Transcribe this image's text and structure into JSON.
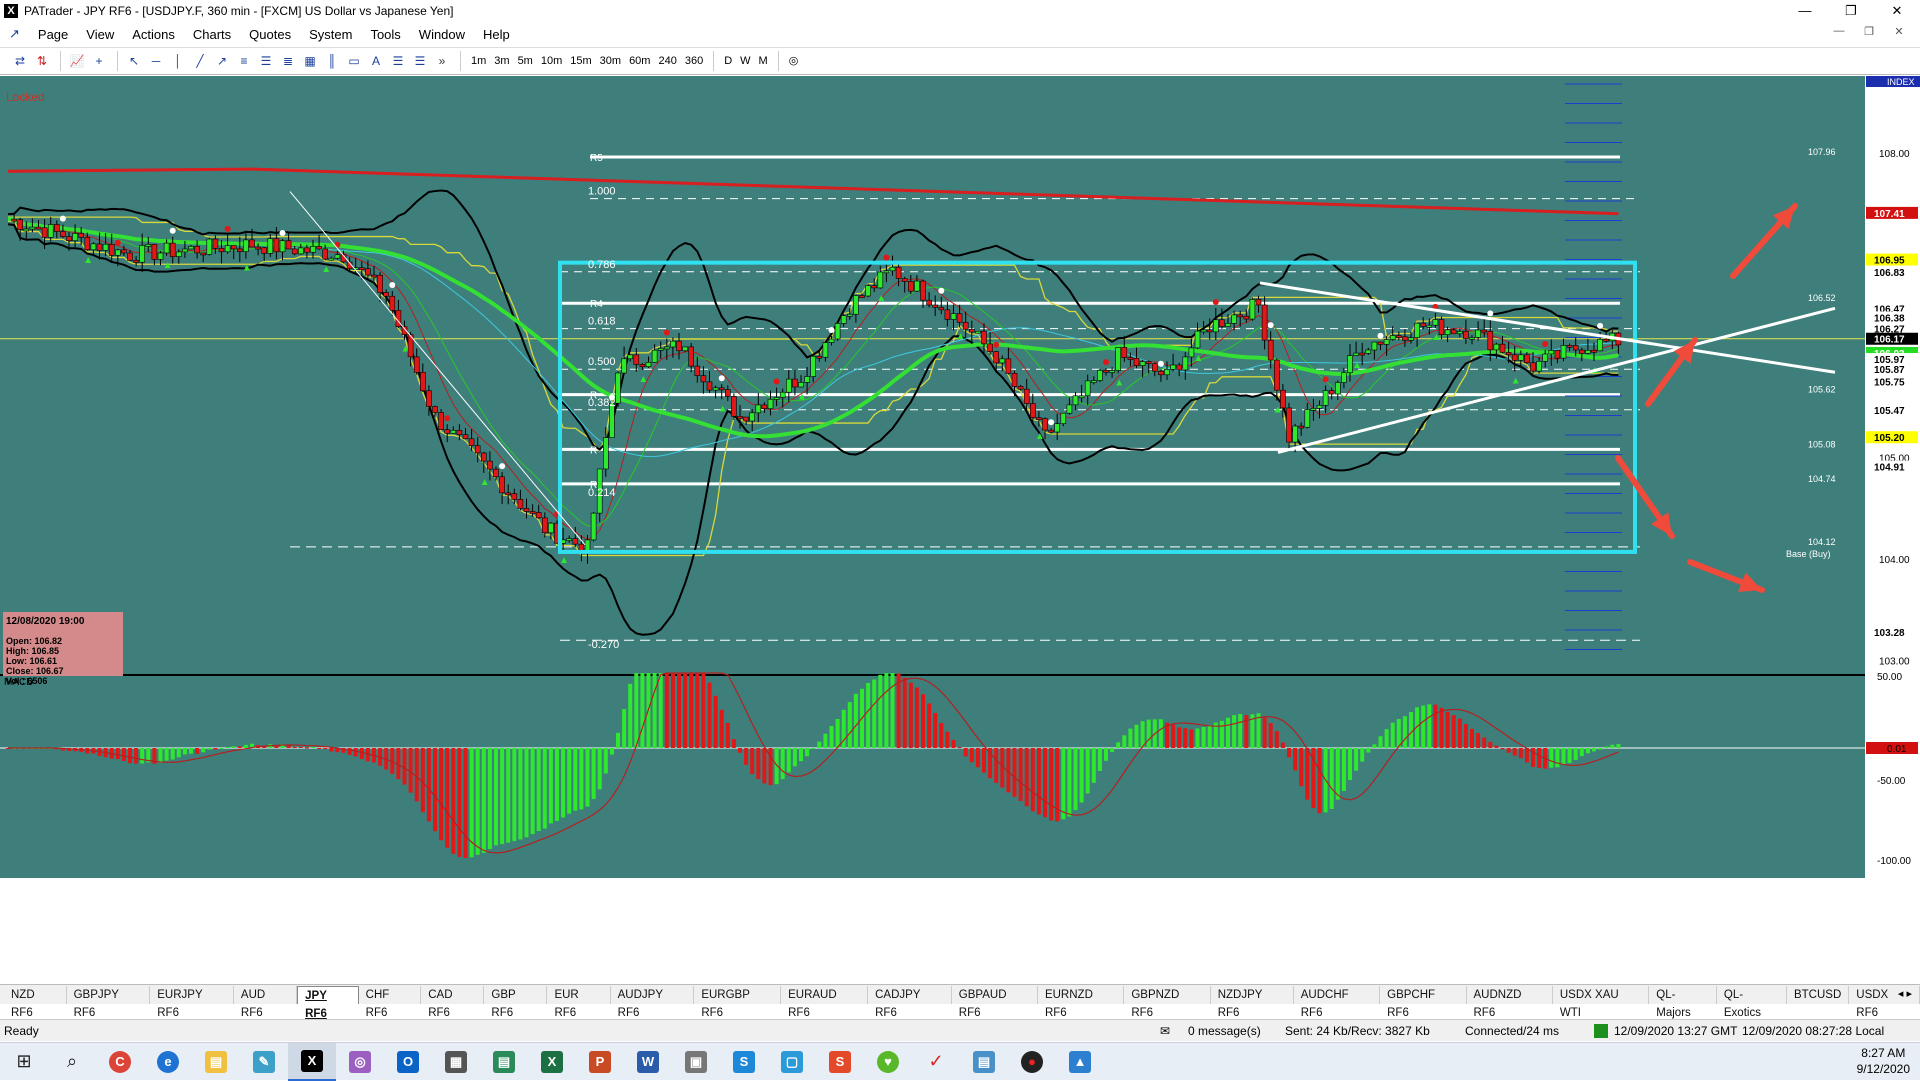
{
  "window": {
    "title": "PATrader - JPY RF6 - [USDJPY.F, 360 min - [FXCM] US Dollar vs Japanese Yen]",
    "app_icon": "X"
  },
  "menu": [
    "Page",
    "View",
    "Actions",
    "Charts",
    "Quotes",
    "System",
    "Tools",
    "Window",
    "Help"
  ],
  "toolbar": {
    "timeframes": [
      "1m",
      "3m",
      "5m",
      "10m",
      "15m",
      "30m",
      "60m",
      "240",
      "360",
      "D",
      "W",
      "M"
    ]
  },
  "chart": {
    "locked_label": "Locked",
    "index_label": "INDEX",
    "fib_labels": [
      "1.000",
      "0.786",
      "0.618",
      "0.500",
      "0.382",
      "0.214",
      "-0.270"
    ],
    "pivot_labels": [
      "R5",
      "R4",
      "R",
      "R",
      "R",
      "R3",
      "R3",
      "R2",
      "R2",
      "R1",
      "Base (Buy)"
    ],
    "pivot_values": [
      "107.96",
      "106.52",
      "105.62",
      "105.08",
      "104.74",
      "104.12"
    ],
    "price_axis": {
      "ticks": [
        "108.00",
        "105.00",
        "104.00",
        "103.00"
      ],
      "tags": [
        {
          "v": "107.41",
          "c": "#d21010",
          "t": "#fff"
        },
        {
          "v": "106.95",
          "c": "#ffff00",
          "t": "#000"
        },
        {
          "v": "106.83",
          "c": "#ffffff",
          "t": "#000"
        },
        {
          "v": "106.47",
          "c": "#ffffff",
          "t": "#000"
        },
        {
          "v": "106.38",
          "c": "#ffffff",
          "t": "#000"
        },
        {
          "v": "106.27",
          "c": "#ffffff",
          "t": "#000"
        },
        {
          "v": "106.17",
          "c": "#000000",
          "t": "#fff"
        },
        {
          "v": "106.03",
          "c": "#22dd22",
          "t": "#fff"
        },
        {
          "v": "105.97",
          "c": "#ffffff",
          "t": "#000"
        },
        {
          "v": "105.87",
          "c": "#ffffff",
          "t": "#000"
        },
        {
          "v": "105.75",
          "c": "#ffffff",
          "t": "#000"
        },
        {
          "v": "105.47",
          "c": "#ffffff",
          "t": "#000"
        },
        {
          "v": "105.20",
          "c": "#ffff00",
          "t": "#000"
        },
        {
          "v": "104.91",
          "c": "#ffffff",
          "t": "#000"
        },
        {
          "v": "103.28",
          "c": "#ffffff",
          "t": "#000"
        }
      ]
    },
    "ohlc_box": {
      "date": "12/08/2020 19:00",
      "open": "Open: 106.82",
      "high": "High: 106.85",
      "low": "Low: 106.61",
      "close": "Close: 106.67",
      "vol": "Vol.: 6506"
    },
    "macd": {
      "label": "MACD",
      "ticks": [
        "50.00",
        "-50.00",
        "-100.00"
      ],
      "tag": "0.01"
    },
    "colors": {
      "bg": "#3e7f7c",
      "bull": "#2ee82e",
      "bear": "#e01818",
      "ema200": "#d81e1e",
      "ma_green": "#33e033",
      "rect": "#2fe0f0",
      "arrows": "#f04a3a"
    }
  },
  "tabs": [
    "NZD RF6",
    "GBPJPY RF6",
    "EURJPY RF6",
    "AUD RF6",
    "JPY RF6",
    "CHF RF6",
    "CAD RF6",
    "GBP RF6",
    "EUR RF6",
    "AUDJPY RF6",
    "EURGBP RF6",
    "EURAUD RF6",
    "CADJPY RF6",
    "GBPAUD RF6",
    "EURNZD RF6",
    "GBPNZD RF6",
    "NZDJPY RF6",
    "AUDCHF RF6",
    "GBPCHF RF6",
    "AUDNZD RF6",
    "USDX XAU WTI",
    "QL-Majors",
    "QL-Exotics",
    "BTCUSD",
    "USDX RF6"
  ],
  "active_tab": "JPY RF6",
  "status": {
    "ready": "Ready",
    "messages": "0 message(s)",
    "traffic": "Sent: 24 Kb/Recv: 3827 Kb",
    "connected": "Connected/24 ms",
    "gmt": "12/09/2020 13:27 GMT",
    "local": "12/09/2020 08:27:28 Local"
  },
  "taskbar": {
    "time": "8:27 AM",
    "date": "9/12/2020"
  }
}
